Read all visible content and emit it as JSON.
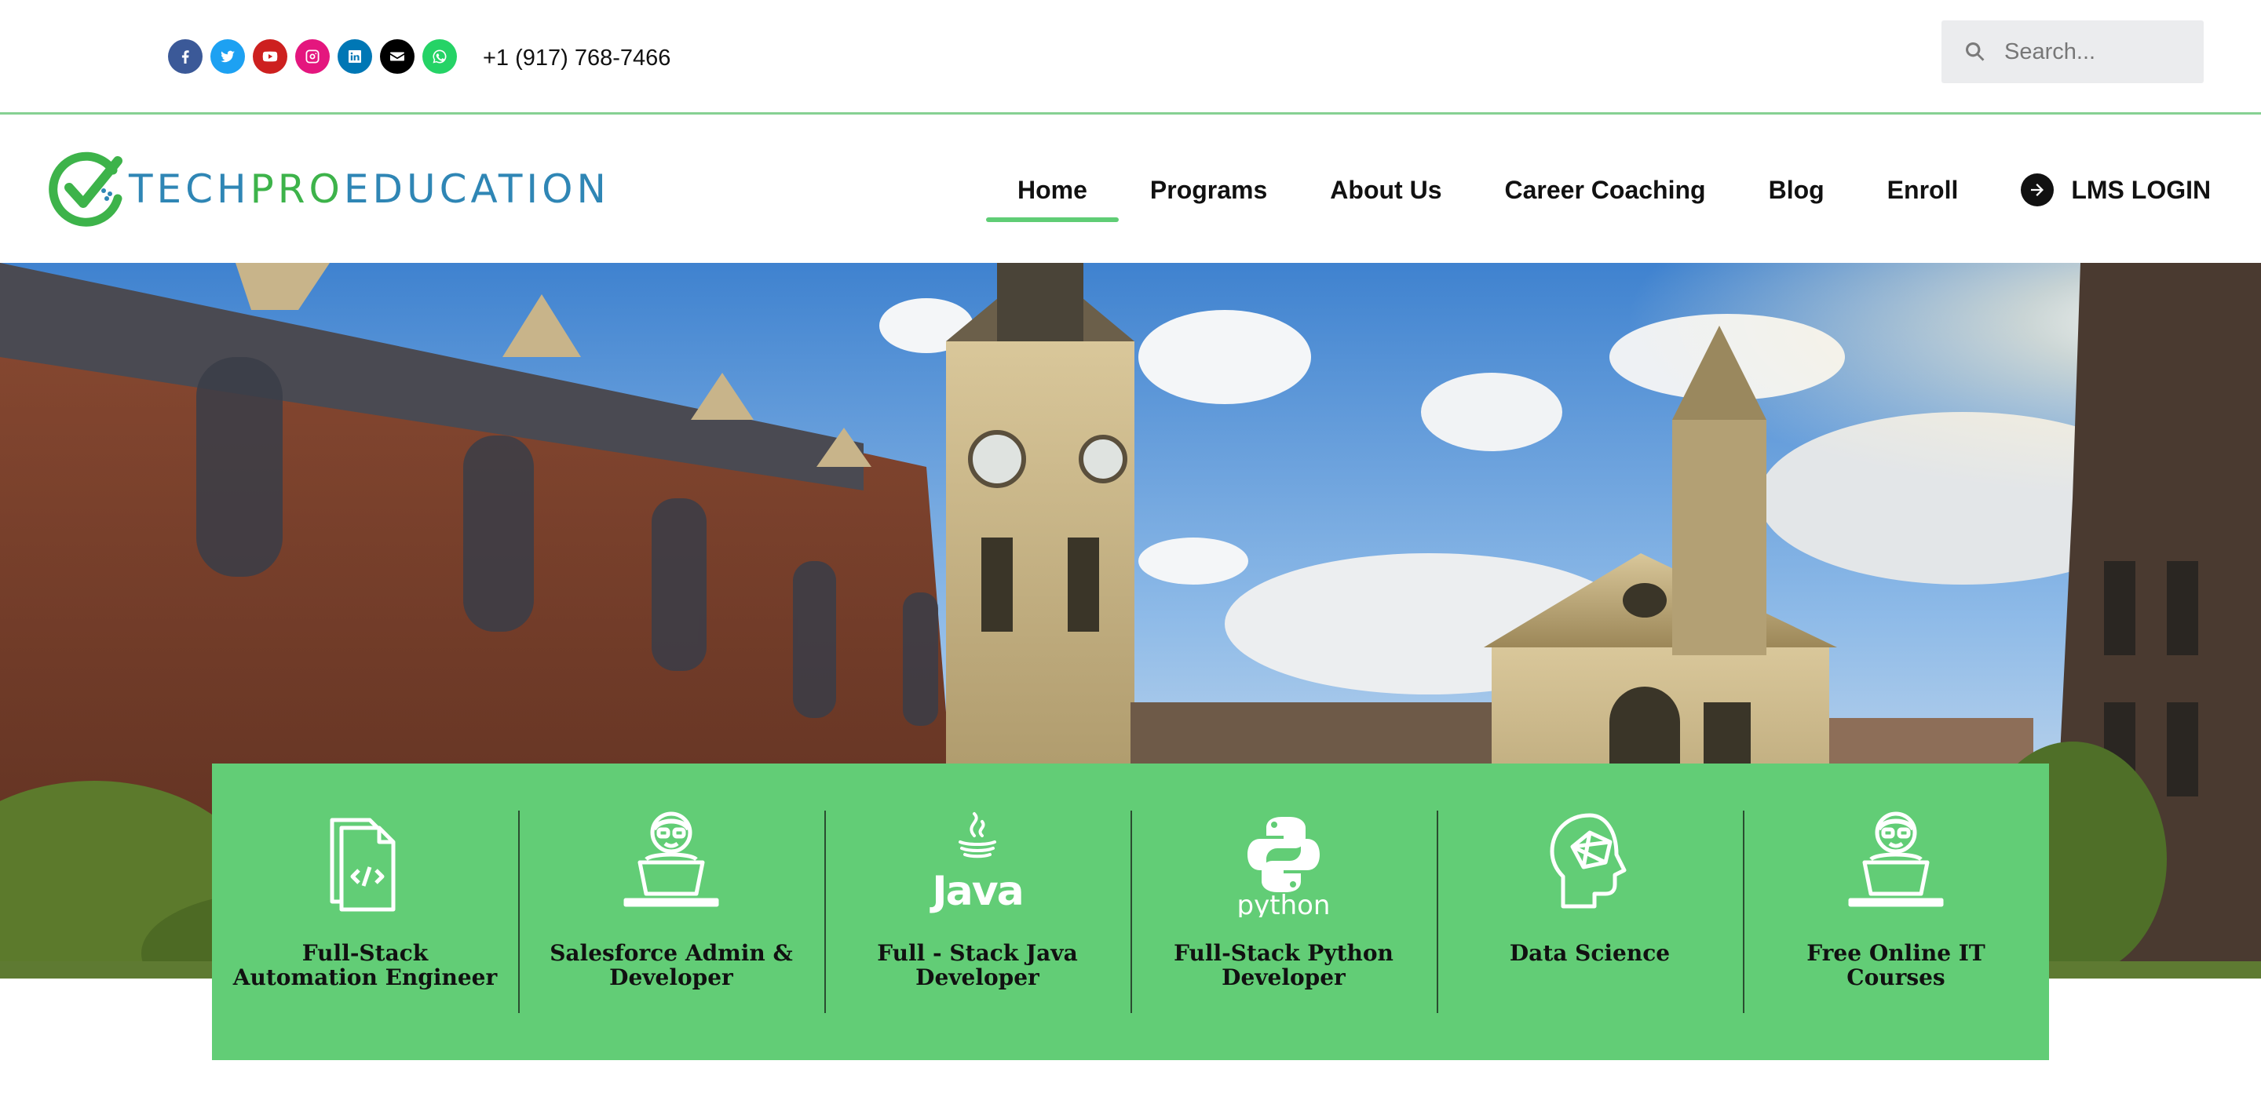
{
  "topbar": {
    "socials": [
      {
        "icon": "facebook-icon",
        "color": "#3b5998"
      },
      {
        "icon": "twitter-icon",
        "color": "#1da1f2"
      },
      {
        "icon": "youtube-icon",
        "color": "#cd201f"
      },
      {
        "icon": "instagram-icon",
        "color": "#e4167e"
      },
      {
        "icon": "linkedin-icon",
        "color": "#0077b5"
      },
      {
        "icon": "envelope-icon",
        "color": "#000000"
      },
      {
        "icon": "whatsapp-icon",
        "color": "#25d366"
      }
    ],
    "phone": "+1 (917) 768-7466",
    "search_placeholder": "Search..."
  },
  "logo": {
    "part1": "TECH",
    "part2": "PRO",
    "part3": "EDUCATION"
  },
  "nav": {
    "items": [
      "Home",
      "Programs",
      "About Us",
      "Career Coaching",
      "Blog",
      "Enroll"
    ],
    "active": "Home",
    "lms_label": "LMS LOGIN"
  },
  "colors": {
    "accent_green": "#62cd76",
    "brand_blue": "#2f86b5",
    "brand_green": "#3db34a"
  },
  "programs": [
    {
      "label": "Full-Stack Automation Engineer",
      "icon": "code-document-icon"
    },
    {
      "label": "Salesforce Admin & Developer",
      "icon": "developer-laptop-icon"
    },
    {
      "label": "Full - Stack Java Developer",
      "icon": "java-logo-icon"
    },
    {
      "label": "Full-Stack Python Developer",
      "icon": "python-logo-icon"
    },
    {
      "label": "Data Science",
      "icon": "brain-head-icon"
    },
    {
      "label": "Free Online IT Courses",
      "icon": "developer-laptop-icon"
    }
  ]
}
